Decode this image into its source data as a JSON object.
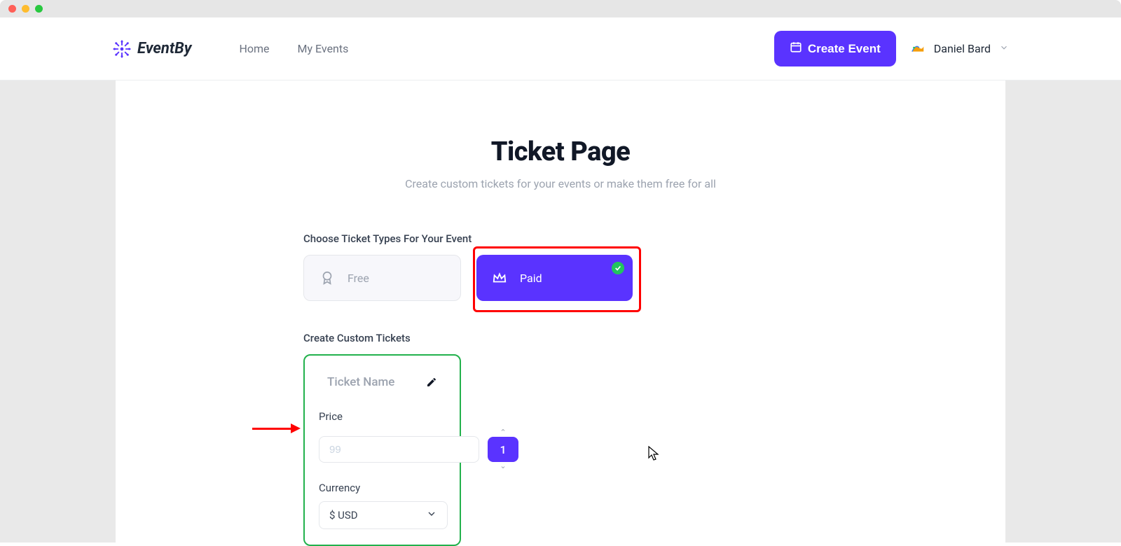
{
  "brand": "EventBy",
  "nav": {
    "home": "Home",
    "my_events": "My Events"
  },
  "header": {
    "create_button": "Create Event",
    "user_name": "Daniel Bard"
  },
  "page": {
    "title": "Ticket Page",
    "subtitle": "Create custom tickets for your events or make them free for all"
  },
  "ticket_type": {
    "label": "Choose Ticket Types For Your Event",
    "options": {
      "free": "Free",
      "paid": "Paid"
    },
    "selected": "paid"
  },
  "custom": {
    "label": "Create Custom Tickets",
    "ticket_name_placeholder": "Ticket Name",
    "price_label": "Price",
    "price_placeholder": "99",
    "quantity": "1",
    "currency_label": "Currency",
    "currency_value": "$ USD"
  }
}
